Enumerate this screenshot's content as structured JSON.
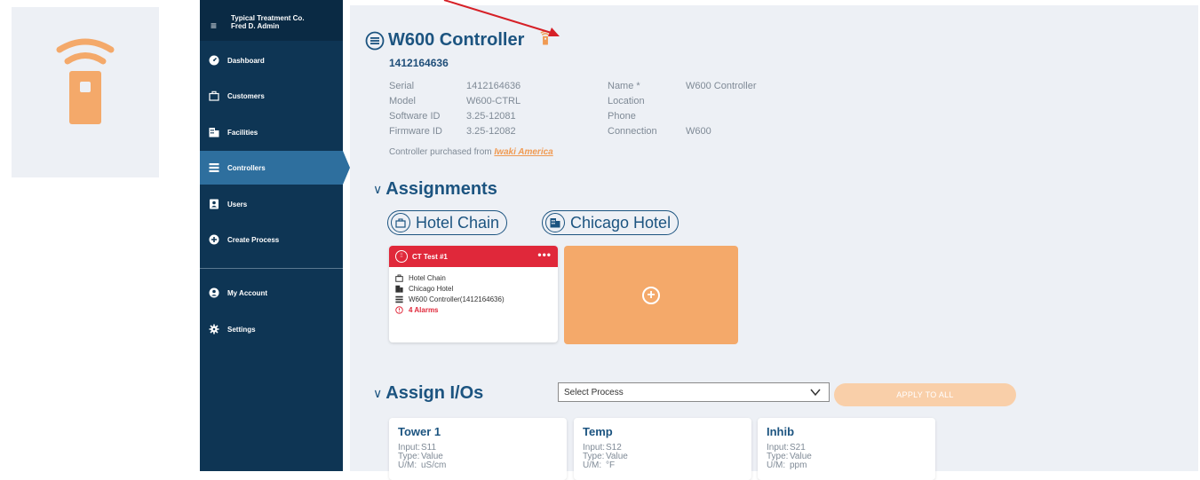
{
  "sidebar": {
    "org": "Typical Treatment Co.",
    "user": "Fred D. Admin",
    "items": [
      {
        "label": "Dashboard",
        "icon": "dashboard-icon"
      },
      {
        "label": "Customers",
        "icon": "briefcase-icon"
      },
      {
        "label": "Facilities",
        "icon": "building-icon"
      },
      {
        "label": "Controllers",
        "icon": "controller-icon",
        "active": true
      },
      {
        "label": "Users",
        "icon": "user-badge-icon"
      },
      {
        "label": "Create Process",
        "icon": "plus-circle-icon"
      },
      {
        "label": "My Account",
        "icon": "account-icon"
      },
      {
        "label": "Settings",
        "icon": "gear-icon"
      }
    ]
  },
  "controller": {
    "title": "W600 Controller",
    "serial_heading": "1412164636",
    "details_left": [
      {
        "key": "Serial",
        "value": "1412164636"
      },
      {
        "key": "Model",
        "value": "W600-CTRL"
      },
      {
        "key": "Software ID",
        "value": "3.25-12081"
      },
      {
        "key": "Firmware ID",
        "value": "3.25-12082"
      }
    ],
    "details_right": [
      {
        "key": "Name *",
        "value": "W600 Controller"
      },
      {
        "key": "Location",
        "value": ""
      },
      {
        "key": "Phone",
        "value": ""
      },
      {
        "key": "Connection",
        "value": "W600"
      }
    ],
    "purchase_prefix": "Controller purchased from ",
    "purchase_vendor": "Iwaki America"
  },
  "assignments": {
    "title": "Assignments",
    "customer": "Hotel Chain",
    "facility": "Chicago Hotel",
    "process_card": {
      "name": "CT Test #1",
      "menu": "•••",
      "customer": "Hotel Chain",
      "facility": "Chicago Hotel",
      "controller": "W600 Controller(1412164636)",
      "alarms": "4 Alarms"
    },
    "add_symbol": "+"
  },
  "assign_ios": {
    "title": "Assign I/Os",
    "select_value": "Select Process",
    "apply_label": "APPLY TO ALL",
    "cards": [
      {
        "title": "Tower 1",
        "input": "S11",
        "type": "Value",
        "um": "uS/cm"
      },
      {
        "title": "Temp",
        "input": "S12",
        "type": "Value",
        "um": "°F"
      },
      {
        "title": "Inhib",
        "input": "S21",
        "type": "Value",
        "um": "ppm"
      }
    ],
    "labels": {
      "input": "Input:",
      "type": "Type:",
      "um": "U/M:"
    }
  },
  "colors": {
    "sidebar": "#0e3554",
    "active": "#2e6f9e",
    "accent_orange": "#f4a96a",
    "alarm_red": "#e0283a",
    "title_blue": "#1c5480"
  }
}
